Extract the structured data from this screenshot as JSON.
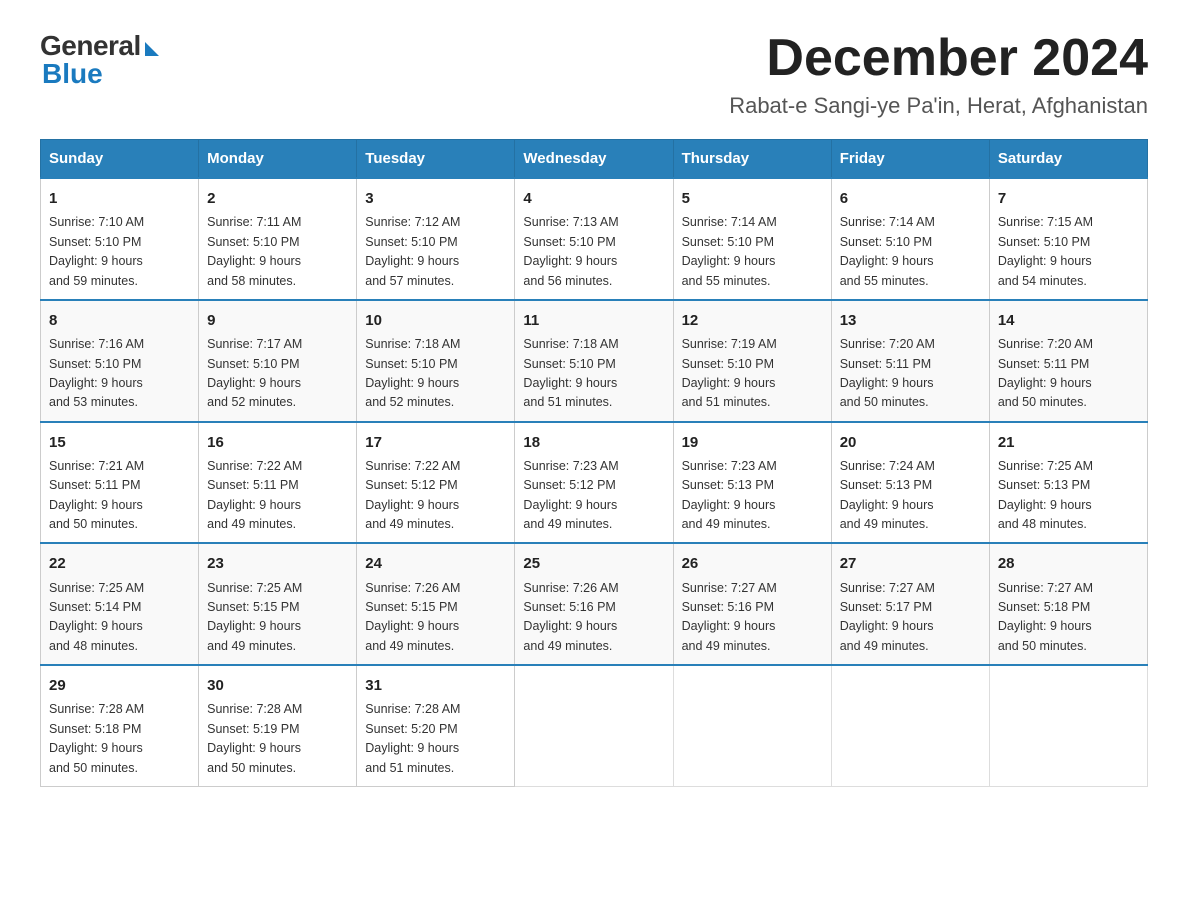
{
  "logo": {
    "general": "General",
    "blue": "Blue"
  },
  "title": {
    "month": "December 2024",
    "location": "Rabat-e Sangi-ye Pa'in, Herat, Afghanistan"
  },
  "headers": [
    "Sunday",
    "Monday",
    "Tuesday",
    "Wednesday",
    "Thursday",
    "Friday",
    "Saturday"
  ],
  "weeks": [
    [
      {
        "day": "1",
        "info": "Sunrise: 7:10 AM\nSunset: 5:10 PM\nDaylight: 9 hours\nand 59 minutes."
      },
      {
        "day": "2",
        "info": "Sunrise: 7:11 AM\nSunset: 5:10 PM\nDaylight: 9 hours\nand 58 minutes."
      },
      {
        "day": "3",
        "info": "Sunrise: 7:12 AM\nSunset: 5:10 PM\nDaylight: 9 hours\nand 57 minutes."
      },
      {
        "day": "4",
        "info": "Sunrise: 7:13 AM\nSunset: 5:10 PM\nDaylight: 9 hours\nand 56 minutes."
      },
      {
        "day": "5",
        "info": "Sunrise: 7:14 AM\nSunset: 5:10 PM\nDaylight: 9 hours\nand 55 minutes."
      },
      {
        "day": "6",
        "info": "Sunrise: 7:14 AM\nSunset: 5:10 PM\nDaylight: 9 hours\nand 55 minutes."
      },
      {
        "day": "7",
        "info": "Sunrise: 7:15 AM\nSunset: 5:10 PM\nDaylight: 9 hours\nand 54 minutes."
      }
    ],
    [
      {
        "day": "8",
        "info": "Sunrise: 7:16 AM\nSunset: 5:10 PM\nDaylight: 9 hours\nand 53 minutes."
      },
      {
        "day": "9",
        "info": "Sunrise: 7:17 AM\nSunset: 5:10 PM\nDaylight: 9 hours\nand 52 minutes."
      },
      {
        "day": "10",
        "info": "Sunrise: 7:18 AM\nSunset: 5:10 PM\nDaylight: 9 hours\nand 52 minutes."
      },
      {
        "day": "11",
        "info": "Sunrise: 7:18 AM\nSunset: 5:10 PM\nDaylight: 9 hours\nand 51 minutes."
      },
      {
        "day": "12",
        "info": "Sunrise: 7:19 AM\nSunset: 5:10 PM\nDaylight: 9 hours\nand 51 minutes."
      },
      {
        "day": "13",
        "info": "Sunrise: 7:20 AM\nSunset: 5:11 PM\nDaylight: 9 hours\nand 50 minutes."
      },
      {
        "day": "14",
        "info": "Sunrise: 7:20 AM\nSunset: 5:11 PM\nDaylight: 9 hours\nand 50 minutes."
      }
    ],
    [
      {
        "day": "15",
        "info": "Sunrise: 7:21 AM\nSunset: 5:11 PM\nDaylight: 9 hours\nand 50 minutes."
      },
      {
        "day": "16",
        "info": "Sunrise: 7:22 AM\nSunset: 5:11 PM\nDaylight: 9 hours\nand 49 minutes."
      },
      {
        "day": "17",
        "info": "Sunrise: 7:22 AM\nSunset: 5:12 PM\nDaylight: 9 hours\nand 49 minutes."
      },
      {
        "day": "18",
        "info": "Sunrise: 7:23 AM\nSunset: 5:12 PM\nDaylight: 9 hours\nand 49 minutes."
      },
      {
        "day": "19",
        "info": "Sunrise: 7:23 AM\nSunset: 5:13 PM\nDaylight: 9 hours\nand 49 minutes."
      },
      {
        "day": "20",
        "info": "Sunrise: 7:24 AM\nSunset: 5:13 PM\nDaylight: 9 hours\nand 49 minutes."
      },
      {
        "day": "21",
        "info": "Sunrise: 7:25 AM\nSunset: 5:13 PM\nDaylight: 9 hours\nand 48 minutes."
      }
    ],
    [
      {
        "day": "22",
        "info": "Sunrise: 7:25 AM\nSunset: 5:14 PM\nDaylight: 9 hours\nand 48 minutes."
      },
      {
        "day": "23",
        "info": "Sunrise: 7:25 AM\nSunset: 5:15 PM\nDaylight: 9 hours\nand 49 minutes."
      },
      {
        "day": "24",
        "info": "Sunrise: 7:26 AM\nSunset: 5:15 PM\nDaylight: 9 hours\nand 49 minutes."
      },
      {
        "day": "25",
        "info": "Sunrise: 7:26 AM\nSunset: 5:16 PM\nDaylight: 9 hours\nand 49 minutes."
      },
      {
        "day": "26",
        "info": "Sunrise: 7:27 AM\nSunset: 5:16 PM\nDaylight: 9 hours\nand 49 minutes."
      },
      {
        "day": "27",
        "info": "Sunrise: 7:27 AM\nSunset: 5:17 PM\nDaylight: 9 hours\nand 49 minutes."
      },
      {
        "day": "28",
        "info": "Sunrise: 7:27 AM\nSunset: 5:18 PM\nDaylight: 9 hours\nand 50 minutes."
      }
    ],
    [
      {
        "day": "29",
        "info": "Sunrise: 7:28 AM\nSunset: 5:18 PM\nDaylight: 9 hours\nand 50 minutes."
      },
      {
        "day": "30",
        "info": "Sunrise: 7:28 AM\nSunset: 5:19 PM\nDaylight: 9 hours\nand 50 minutes."
      },
      {
        "day": "31",
        "info": "Sunrise: 7:28 AM\nSunset: 5:20 PM\nDaylight: 9 hours\nand 51 minutes."
      },
      {
        "day": "",
        "info": ""
      },
      {
        "day": "",
        "info": ""
      },
      {
        "day": "",
        "info": ""
      },
      {
        "day": "",
        "info": ""
      }
    ]
  ]
}
